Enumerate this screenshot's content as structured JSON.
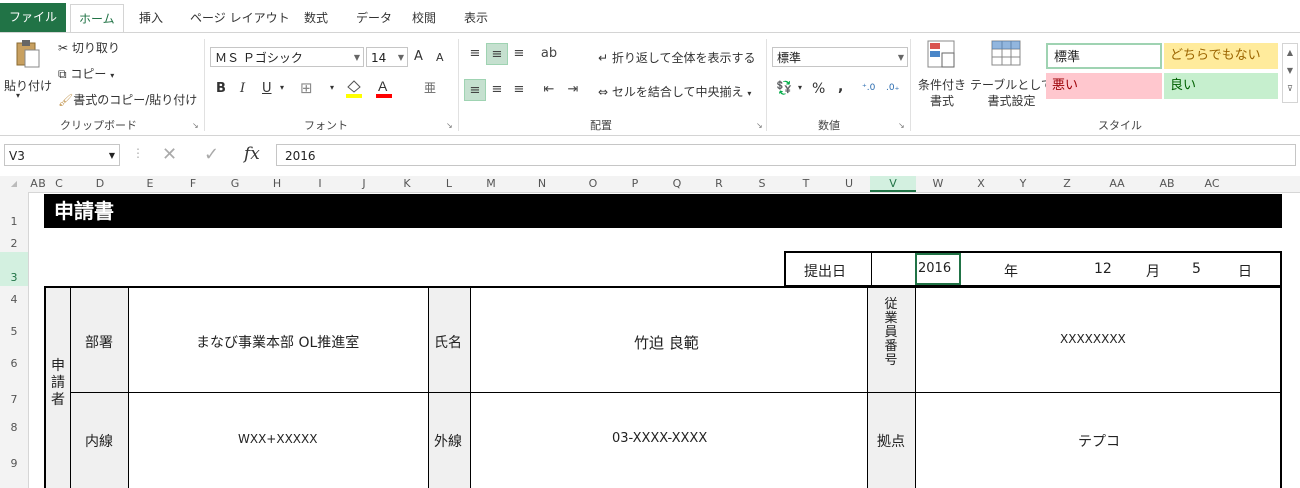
{
  "tabs": {
    "file": "ファイル",
    "home": "ホーム",
    "insert": "挿入",
    "layout": "ページ レイアウト",
    "formulas": "数式",
    "data": "データ",
    "review": "校閲",
    "view": "表示"
  },
  "clipboard": {
    "paste": "貼り付け",
    "cut": "切り取り",
    "copy": "コピー",
    "format_painter": "書式のコピー/貼り付け",
    "label": "クリップボード"
  },
  "font": {
    "name": "ＭＳ Ｐゴシック",
    "size": "14",
    "grow": "A",
    "shrink": "A",
    "bold": "B",
    "italic": "I",
    "underline": "U",
    "label": "フォント"
  },
  "alignment": {
    "wrap": "折り返して全体を表示する",
    "merge": "セルを結合して中央揃え",
    "label": "配置"
  },
  "number": {
    "format": "標準",
    "percent": "%",
    "comma": ",",
    "label": "数値"
  },
  "styles": {
    "conditional": "条件付き\n書式",
    "table": "テーブルとして\n書式設定",
    "normal": "標準",
    "neutral": "どちらでもない",
    "bad": "悪い",
    "good": "良い",
    "label": "スタイル"
  },
  "formula_bar": {
    "cell_ref": "V3",
    "fx": "fx",
    "value": "2016"
  },
  "columns": [
    "A",
    "B",
    "C",
    "D",
    "E",
    "F",
    "G",
    "H",
    "I",
    "J",
    "K",
    "L",
    "M",
    "N",
    "O",
    "P",
    "Q",
    "R",
    "S",
    "T",
    "U",
    "V",
    "W",
    "X",
    "Y",
    "Z",
    "AA",
    "AB",
    "AC"
  ],
  "rows": [
    "1",
    "2",
    "3",
    "4",
    "5",
    "6",
    "7",
    "8",
    "9"
  ],
  "sheet": {
    "title": "申請書",
    "date_label": "提出日",
    "year_value": "2016",
    "year_unit": "年",
    "month_value": "12",
    "month_unit": "月",
    "day_value": "5",
    "day_unit": "日",
    "applicant_label": "申\n請\n者",
    "dept_label": "部署",
    "dept_value": "まなび事業本部 OL推進室",
    "name_label": "氏名",
    "name_value": "竹迫 良範",
    "emp_label": "従\n業\n員\n番\n号",
    "emp_value": "XXXXXXXX",
    "ext_label": "内線",
    "ext_value": "WXX+XXXXX",
    "outside_label": "外線",
    "outside_value": "03-XXXX-XXXX",
    "base_label": "拠点",
    "base_value": "テプコ"
  },
  "colors": {
    "excel_green": "#217346",
    "neutral_bg": "#ffeb9c",
    "neutral_fg": "#9c6500",
    "bad_bg": "#ffc7ce",
    "bad_fg": "#9c0006",
    "good_bg": "#c6efce",
    "good_fg": "#006100"
  }
}
